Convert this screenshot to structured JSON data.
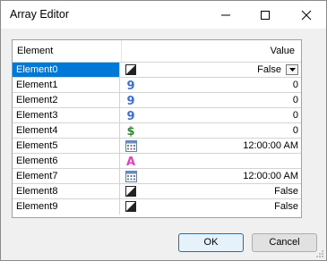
{
  "window": {
    "title": "Array Editor"
  },
  "grid": {
    "headers": {
      "name": "Element",
      "value": "Value"
    },
    "rows": [
      {
        "name": "Element0",
        "icon": "boolean-icon",
        "value": "False",
        "selected": true,
        "dropdown": true
      },
      {
        "name": "Element1",
        "icon": "integer-icon",
        "value": "0"
      },
      {
        "name": "Element2",
        "icon": "integer-icon",
        "value": "0"
      },
      {
        "name": "Element3",
        "icon": "integer-icon",
        "value": "0"
      },
      {
        "name": "Element4",
        "icon": "currency-icon",
        "value": "0"
      },
      {
        "name": "Element5",
        "icon": "calendar-icon",
        "value": "12:00:00 AM"
      },
      {
        "name": "Element6",
        "icon": "string-icon",
        "value": ""
      },
      {
        "name": "Element7",
        "icon": "calendar-icon",
        "value": "12:00:00 AM"
      },
      {
        "name": "Element8",
        "icon": "boolean-icon",
        "value": "False"
      },
      {
        "name": "Element9",
        "icon": "boolean-icon",
        "value": "False"
      }
    ]
  },
  "buttons": {
    "ok": "OK",
    "cancel": "Cancel"
  },
  "colors": {
    "selection": "#0078d7",
    "integer": "#3a6fd8",
    "currency": "#2e8b2e",
    "string": "#e040c0"
  }
}
